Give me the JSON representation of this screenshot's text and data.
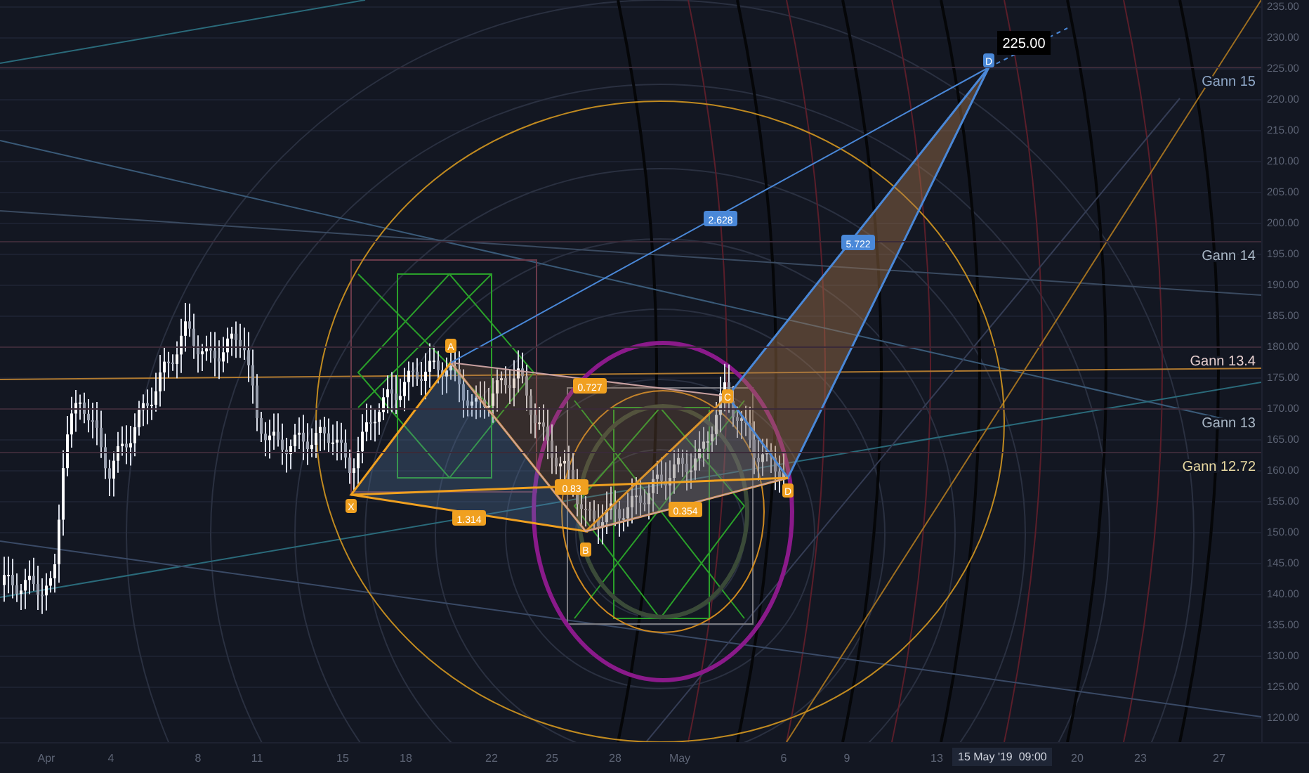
{
  "price_axis": {
    "labels": [
      "235.00",
      "230.00",
      "225.00",
      "220.00",
      "215.00",
      "210.00",
      "205.00",
      "200.00",
      "195.00",
      "190.00",
      "185.00",
      "180.00",
      "175.00",
      "170.00",
      "165.00",
      "160.00",
      "155.00",
      "150.00",
      "145.00",
      "140.00",
      "135.00",
      "130.00",
      "125.00",
      "120.00"
    ]
  },
  "time_axis": {
    "labels": [
      "Apr",
      "4",
      "8",
      "11",
      "15",
      "18",
      "22",
      "25",
      "28",
      "May",
      "6",
      "9",
      "13",
      "20",
      "23",
      "27"
    ]
  },
  "crosshair": {
    "price": "225.00",
    "time": "15 May '19  09:00"
  },
  "gann_levels": [
    {
      "label": "Gann 15",
      "color": "#8fa8c8"
    },
    {
      "label": "Gann 14",
      "color": "#a9b7c6"
    },
    {
      "label": "Gann 13.4",
      "color": "#e6cfcf"
    },
    {
      "label": "Gann 13",
      "color": "#a9b7c6"
    },
    {
      "label": "Gann 12.72",
      "color": "#e8d9a2"
    }
  ],
  "pattern": {
    "points": [
      "X",
      "A",
      "B",
      "C",
      "D",
      "D"
    ],
    "ratios": [
      "0.727",
      "0.83",
      "1.314",
      "0.354",
      "2.628",
      "5.722"
    ]
  }
}
